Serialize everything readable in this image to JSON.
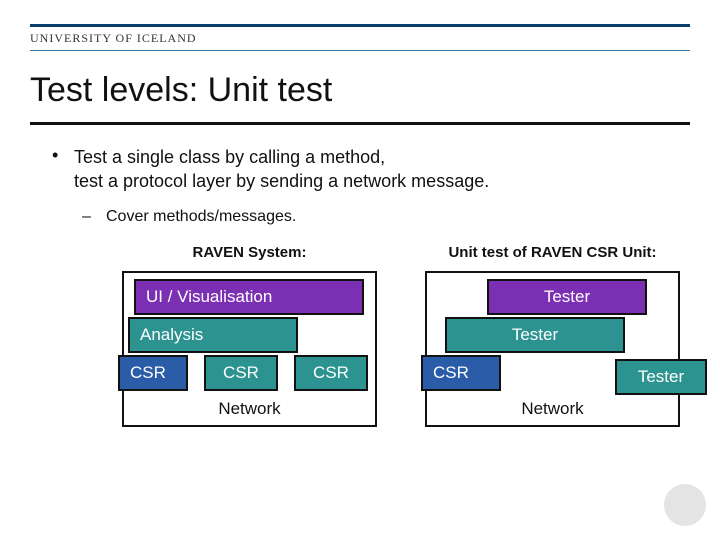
{
  "header": {
    "university": "UNIVERSITY OF ICELAND"
  },
  "title": "Test levels: Unit test",
  "bullet": {
    "line1": "Test a single class by calling a method,",
    "line2": "test a protocol layer by sending a network message.",
    "sub": "Cover methods/messages."
  },
  "diagrams": {
    "left": {
      "title": "RAVEN System:",
      "ui": "UI / Visualisation",
      "analysis": "Analysis",
      "csr1": "CSR",
      "csr2": "CSR",
      "csr3": "CSR",
      "network": "Network"
    },
    "right": {
      "title": "Unit test of RAVEN CSR Unit:",
      "tester1": "Tester",
      "tester2": "Tester",
      "csr": "CSR",
      "tester3": "Tester",
      "network": "Network"
    }
  }
}
